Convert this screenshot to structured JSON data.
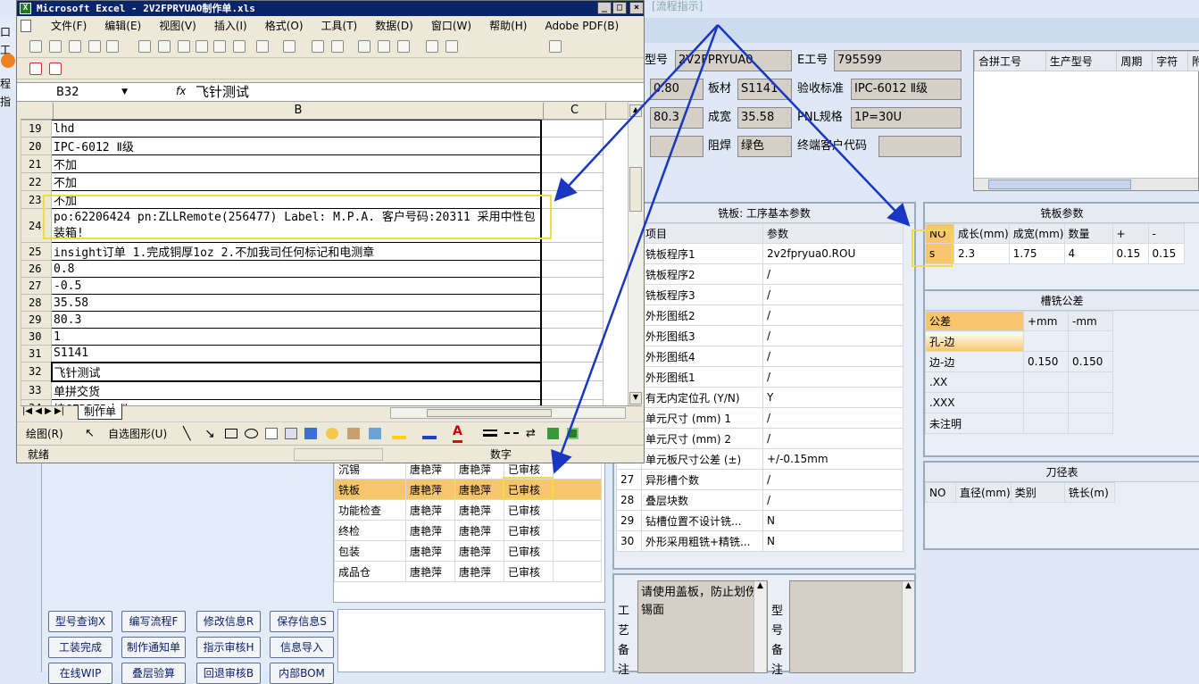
{
  "excel": {
    "title": "Microsoft Excel - 2V2FPRYUAO制作单.xls",
    "menu": [
      "文件(F)",
      "编辑(E)",
      "视图(V)",
      "插入(I)",
      "格式(O)",
      "工具(T)",
      "数据(D)",
      "窗口(W)",
      "帮助(H)",
      "Adobe PDF(B)"
    ],
    "window_buttons": [
      "_",
      "□",
      "×"
    ],
    "name_box": "B32",
    "fx": "fx",
    "formula": "飞针测试",
    "col_b": "B",
    "col_c": "C",
    "rows": [
      {
        "n": "19",
        "v": "lhd"
      },
      {
        "n": "20",
        "v": "IPC-6012 Ⅱ级"
      },
      {
        "n": "21",
        "v": "不加"
      },
      {
        "n": "22",
        "v": "不加"
      },
      {
        "n": "23",
        "v": "不加"
      },
      {
        "n": "24",
        "v": "po:62206424 pn:ZLLRemote(256477) Label: M.P.A. 客户号码:20311  采用中性包装箱!"
      },
      {
        "n": "25",
        "v": "insight订单 1.完成铜厚1oz 2.不加我司任何标记和电测章"
      },
      {
        "n": "26",
        "v": "0.8"
      },
      {
        "n": "27",
        "v": "-0.5"
      },
      {
        "n": "28",
        "v": "35.58"
      },
      {
        "n": "29",
        "v": "80.3"
      },
      {
        "n": "30",
        "v": "1"
      },
      {
        "n": "31",
        "v": "S1141"
      },
      {
        "n": "32",
        "v": "飞针测试"
      },
      {
        "n": "33",
        "v": "单拼交货"
      },
      {
        "n": "34",
        "v": "按GERBER文件"
      }
    ],
    "sheet_tab": "制作单",
    "drawing_bar": {
      "draw": "绘图(R)",
      "autoshape": "自选图形(U)"
    },
    "status": "就绪",
    "status_num": "数字"
  },
  "bg_app": {
    "flow_hint": "[流程指示]",
    "left_stub": [
      "口工",
      "程指"
    ],
    "fields": {
      "model_label": "型号",
      "model_value": "2V2FPRYUA0",
      "eno_label": "E工号",
      "eno_value": "795599",
      "thickness_value": "0.80",
      "board_label": "板材",
      "board_value": "S1141",
      "accept_label": "验收标准",
      "accept_value": "IPC-6012 Ⅱ级",
      "len_value": "80.3",
      "width_label": "成宽",
      "width_value": "35.58",
      "pnl_label": "PNL规格",
      "pnl_value": "1P=30U",
      "solder_label": "阻焊",
      "solder_value": "绿色",
      "endcust_label": "终端客户代码",
      "endcust_value": ""
    },
    "merge_table_headers": [
      "合拼工号",
      "生产型号",
      "周期",
      "字符",
      "附"
    ],
    "routing_panel": {
      "title": "铣板: 工序基本参数",
      "col_item": "项目",
      "col_param": "参数",
      "rows": [
        {
          "no": "",
          "item": "铣板程序1",
          "param": "2v2fpryua0.ROU"
        },
        {
          "no": "",
          "item": "铣板程序2",
          "param": "/"
        },
        {
          "no": "",
          "item": "铣板程序3",
          "param": "/"
        },
        {
          "no": "",
          "item": "外形图纸2",
          "param": "/"
        },
        {
          "no": "",
          "item": "外形图纸3",
          "param": "/"
        },
        {
          "no": "",
          "item": "外形图纸4",
          "param": "/"
        },
        {
          "no": "",
          "item": "外形图纸1",
          "param": "/"
        },
        {
          "no": "",
          "item": "有无内定位孔 (Y/N)",
          "param": "Y"
        },
        {
          "no": "",
          "item": "单元尺寸 (mm) 1",
          "param": "/"
        },
        {
          "no": "",
          "item": "单元尺寸 (mm) 2",
          "param": "/"
        },
        {
          "no": "",
          "item": "单元板尺寸公差 (±)",
          "param": "+/-0.15mm"
        },
        {
          "no": "27",
          "item": "异形槽个数",
          "param": "/"
        },
        {
          "no": "28",
          "item": "叠层块数",
          "param": "/"
        },
        {
          "no": "29",
          "item": "钻槽位置不设计铣...",
          "param": "N"
        },
        {
          "no": "30",
          "item": "外形采用粗铣+精铣...",
          "param": "N"
        }
      ]
    },
    "mill_params": {
      "title": "铣板参数",
      "headers": [
        "NO",
        "成长(mm)",
        "成宽(mm)",
        "数量",
        "+",
        "-"
      ],
      "row": [
        "s",
        "2.3",
        "1.75",
        "4",
        "0.15",
        "0.15"
      ]
    },
    "slot_tolerance": {
      "title": "槽铣公差",
      "headers": [
        "公差",
        "+mm",
        "-mm"
      ],
      "rows": [
        [
          "孔-边",
          "",
          ""
        ],
        [
          "边-边",
          "0.150",
          "0.150"
        ],
        [
          ".XX",
          "",
          ""
        ],
        [
          ".XXX",
          "",
          ""
        ],
        [
          "未注明",
          "",
          ""
        ]
      ]
    },
    "tool_table": {
      "title": "刀径表",
      "headers": [
        "NO",
        "直径(mm)",
        "类别",
        "铣长(m)"
      ]
    },
    "process_list": [
      {
        "proc": "沉锡",
        "a": "唐艳萍",
        "b": "唐艳萍",
        "s": "已审核"
      },
      {
        "proc": "铣板",
        "a": "唐艳萍",
        "b": "唐艳萍",
        "s": "已审核"
      },
      {
        "proc": "功能检查",
        "a": "唐艳萍",
        "b": "唐艳萍",
        "s": "已审核"
      },
      {
        "proc": "终检",
        "a": "唐艳萍",
        "b": "唐艳萍",
        "s": "已审核"
      },
      {
        "proc": "包装",
        "a": "唐艳萍",
        "b": "唐艳萍",
        "s": "已审核"
      },
      {
        "proc": "成品仓",
        "a": "唐艳萍",
        "b": "唐艳萍",
        "s": "已审核"
      }
    ],
    "buttons": [
      "型号查询X",
      "编写流程F",
      "修改信息R",
      "保存信息S",
      "工装完成",
      "制作通知单",
      "指示审核H",
      "信息导入",
      "在线WIP",
      "叠层验算",
      "回退审核B",
      "内部BOM"
    ],
    "craft_note_label": [
      "工",
      "艺",
      "备",
      "注"
    ],
    "craft_note_text": "请使用盖板，防止划伤锡面",
    "model_note_label": [
      "型",
      "号",
      "备",
      "注"
    ]
  },
  "colors": {
    "highlight": "#f7c56b",
    "accent_blue": "#1a37c4",
    "annotation_box": "#ffff66"
  }
}
